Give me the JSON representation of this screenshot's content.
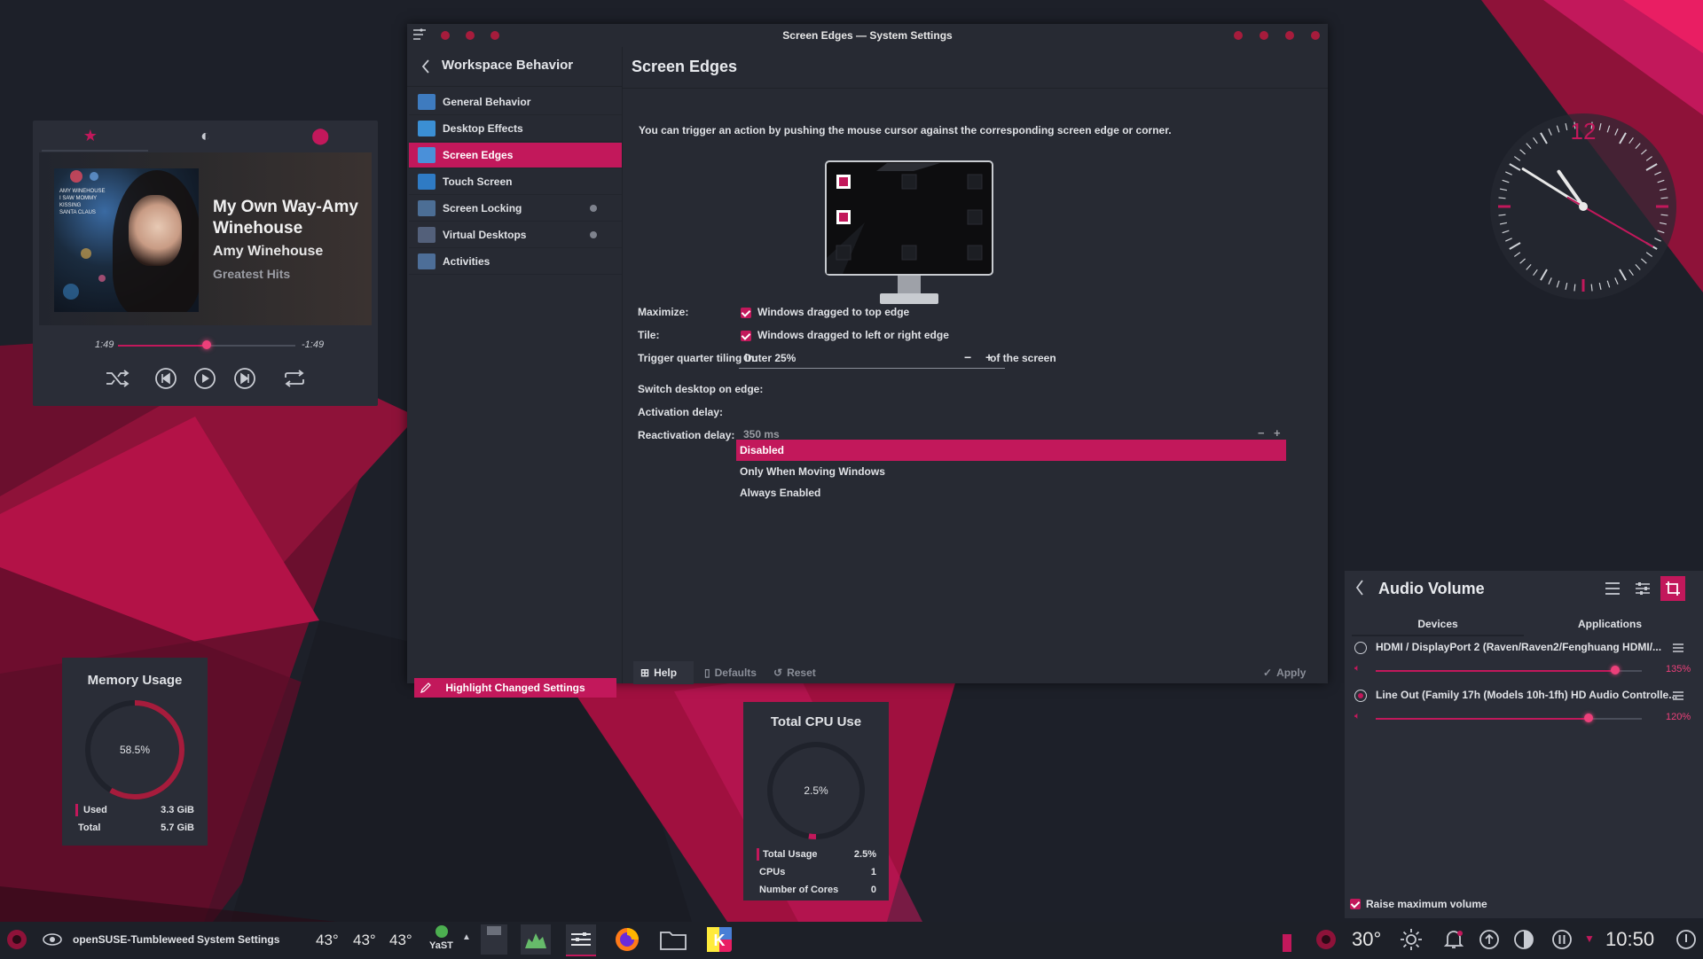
{
  "colors": {
    "accent": "#c2185b",
    "accent_bright": "#ec407a",
    "bg": "#1d2029",
    "panel": "#2a2d37"
  },
  "music": {
    "tabs": [
      "star-icon",
      "media-icon",
      "disc-icon"
    ],
    "title": "My Own Way-Amy Winehouse",
    "artist": "Amy Winehouse",
    "album": "Greatest Hits",
    "cover_text": "AMY WINEHOUSE\nI SAW MOMMY\nKISSING\nSANTA CLAUS",
    "elapsed": "1:49",
    "remaining": "-1:49",
    "progress": 0.5
  },
  "clock": {
    "twelve": "12",
    "hour": 10,
    "minute": 50,
    "second": 20
  },
  "memory": {
    "title": "Memory Usage",
    "percent_label": "58.5%",
    "percent": 58.5,
    "rows": [
      {
        "label": "Used",
        "value": "3.3 GiB"
      },
      {
        "label": "Total",
        "value": "5.7 GiB"
      }
    ]
  },
  "cpu": {
    "title": "Total CPU Use",
    "percent_label": "2.5%",
    "percent": 2.5,
    "rows": [
      {
        "label": "Total Usage",
        "value": "2.5%"
      },
      {
        "label": "CPUs",
        "value": "1"
      },
      {
        "label": "Number of Cores",
        "value": "0"
      }
    ]
  },
  "settings": {
    "window_title": "Screen Edges — System Settings",
    "sidebar": {
      "heading": "Workspace Behavior",
      "items": [
        {
          "label": "General Behavior",
          "color": "#3e7bbf"
        },
        {
          "label": "Desktop Effects",
          "color": "#3b8fd4"
        },
        {
          "label": "Screen Edges",
          "color": "#4a90d9"
        },
        {
          "label": "Touch Screen",
          "color": "#2f7bc4"
        },
        {
          "label": "Screen Locking",
          "color": "#4c6e95"
        },
        {
          "label": "Virtual Desktops",
          "color": "#53607a"
        },
        {
          "label": "Activities",
          "color": "#4d6e98"
        }
      ],
      "highlight_button": "Highlight Changed Settings"
    },
    "page_title": "Screen Edges",
    "description": "You can trigger an action by pushing the mouse cursor against the corresponding screen edge or corner.",
    "maximize": {
      "label": "Maximize:",
      "checkbox": "Windows dragged to top edge",
      "checked": true
    },
    "tile": {
      "label": "Tile:",
      "checkbox": "Windows dragged to left or right edge",
      "checked": true
    },
    "quarter": {
      "label": "Trigger quarter tiling in:",
      "value": "Outer 25%",
      "suffix": "of the screen",
      "minus": "−",
      "plus": "+"
    },
    "switch_desktop": {
      "label": "Switch desktop on edge:",
      "options": [
        "Disabled",
        "Only When Moving Windows",
        "Always Enabled"
      ],
      "selected": "Disabled"
    },
    "activation_delay": {
      "label": "Activation delay:"
    },
    "reactivation_delay": {
      "label": "Reactivation delay:",
      "value": "350 ms",
      "minus": "−",
      "plus": "+"
    },
    "buttons": {
      "help": "Help",
      "defaults": "Defaults",
      "reset": "Reset",
      "apply": "Apply"
    }
  },
  "audio": {
    "title": "Audio Volume",
    "tabs": [
      "Devices",
      "Applications"
    ],
    "devices": [
      {
        "name": "HDMI / DisplayPort 2 (Raven/Raven2/Fenghuang HDMI/...",
        "percent_label": "135%",
        "level": 1.35,
        "default": false
      },
      {
        "name": "Line Out (Family 17h (Models 10h-1fh) HD Audio Controlle...",
        "percent_label": "120%",
        "level": 1.2,
        "default": true
      }
    ],
    "raise_max": "Raise maximum volume",
    "max_level": 1.5
  },
  "taskbar": {
    "task_1": "openSUSE-Tumbleweed",
    "task_2": "System Settings",
    "temps": [
      "43°",
      "43°",
      "43°"
    ],
    "yast": "YaST",
    "weather": "30°",
    "time": "10:50"
  }
}
